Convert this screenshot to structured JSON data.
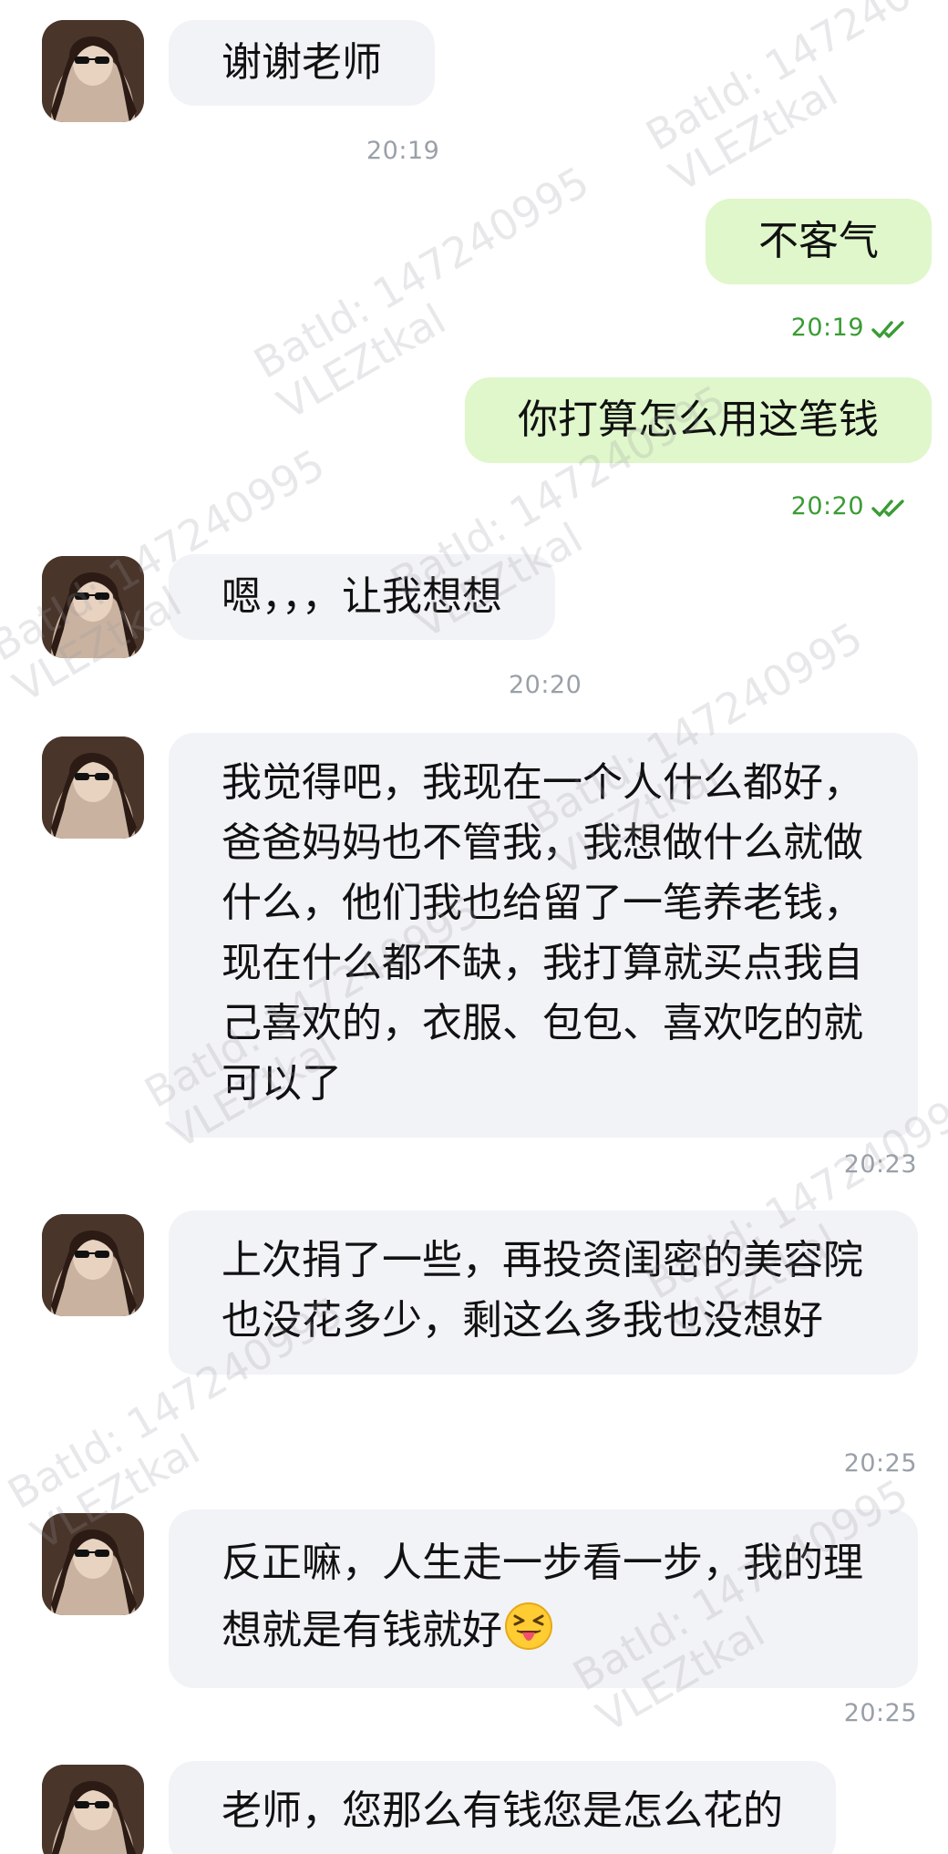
{
  "colors": {
    "incoming_bubble": "#f2f3f7",
    "outgoing_bubble": "#dff7ca",
    "read_time": "#3a9c34",
    "timestamp": "#9aa0a8"
  },
  "watermark": {
    "id_text": "BatId: 147240995",
    "user_text": "VLEZtkal"
  },
  "messages": [
    {
      "text": "谢谢老师",
      "time": "20:19"
    },
    {
      "text": "不客气",
      "time": "20:19"
    },
    {
      "text": "你打算怎么用这笔钱",
      "time": "20:20"
    },
    {
      "text": "嗯，，，让我想想",
      "time": "20:20"
    },
    {
      "text": "我觉得吧，我现在一个人什么都好，爸爸妈妈也不管我，我想做什么就做什么，他们我也给留了一笔养老钱，现在什么都不缺，我打算就买点我自己喜欢的，衣服、包包、喜欢吃的就可以了",
      "time": "20:23"
    },
    {
      "text": "上次捐了一些，再投资闺密的美容院也没花多少，剩这么多我也没想好",
      "time": "20:25"
    },
    {
      "text": "反正嘛，人生走一步看一步，我的理想就是有钱就好",
      "emoji": "squinting-tongue-emoji",
      "time": "20:25"
    },
    {
      "text": "老师，您那么有钱您是怎么花的"
    }
  ]
}
